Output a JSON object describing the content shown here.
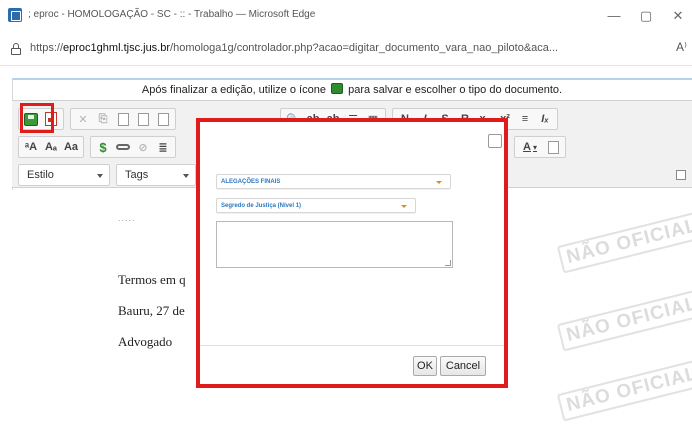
{
  "window": {
    "title": "; eproc - HOMOLOGAÇÃO - SC - :: - Trabalho — Microsoft Edge",
    "minimize": "—",
    "restore": "▢",
    "close": "✕"
  },
  "address_bar": {
    "url_prefix": "https://",
    "url_host": "eproc1ghml.tjsc.jus.br",
    "url_path": "/homologa1g/controlador.php?acao=digitar_documento_vara_nao_piloto&aca...",
    "read_aloud": "A⁾"
  },
  "info_bar": {
    "text_before": "Após finalizar a edição, utilize o ícone",
    "text_after": "para salvar e escolher o tipo do documento."
  },
  "toolbar": {
    "row1": [
      "✕",
      "⎘",
      "📋",
      "📋",
      "📋",
      "⤺",
      "⤻",
      "🔍",
      "ab",
      "ab",
      "☰",
      "▦",
      "N",
      "I",
      "S",
      "R",
      "x₂",
      "x²",
      "≡",
      "Iₓ"
    ],
    "row2": [
      "ᵃA",
      "Aₐ",
      "Aa",
      "$",
      "∞",
      "⊘",
      "≣"
    ],
    "text_color": "A",
    "style_combo": "Estilo",
    "tags_combo": "Tags"
  },
  "document": {
    "dots": ".....",
    "line1": "Termos em q",
    "line2": "Bauru, 27 de",
    "line3": "Advogado",
    "watermark": "NÃO OFICIAL"
  },
  "dialog": {
    "select_type": "ALEGAÇÕES FINAIS",
    "select_secrecy": "Segredo de Justiça (Nível 1)",
    "textarea_value": "",
    "ok_label": "OK",
    "cancel_label": "Cancel"
  },
  "colors": {
    "highlight": "#e01b1b",
    "select_text": "#2b78c2",
    "select_arrow": "#e08a1e"
  }
}
